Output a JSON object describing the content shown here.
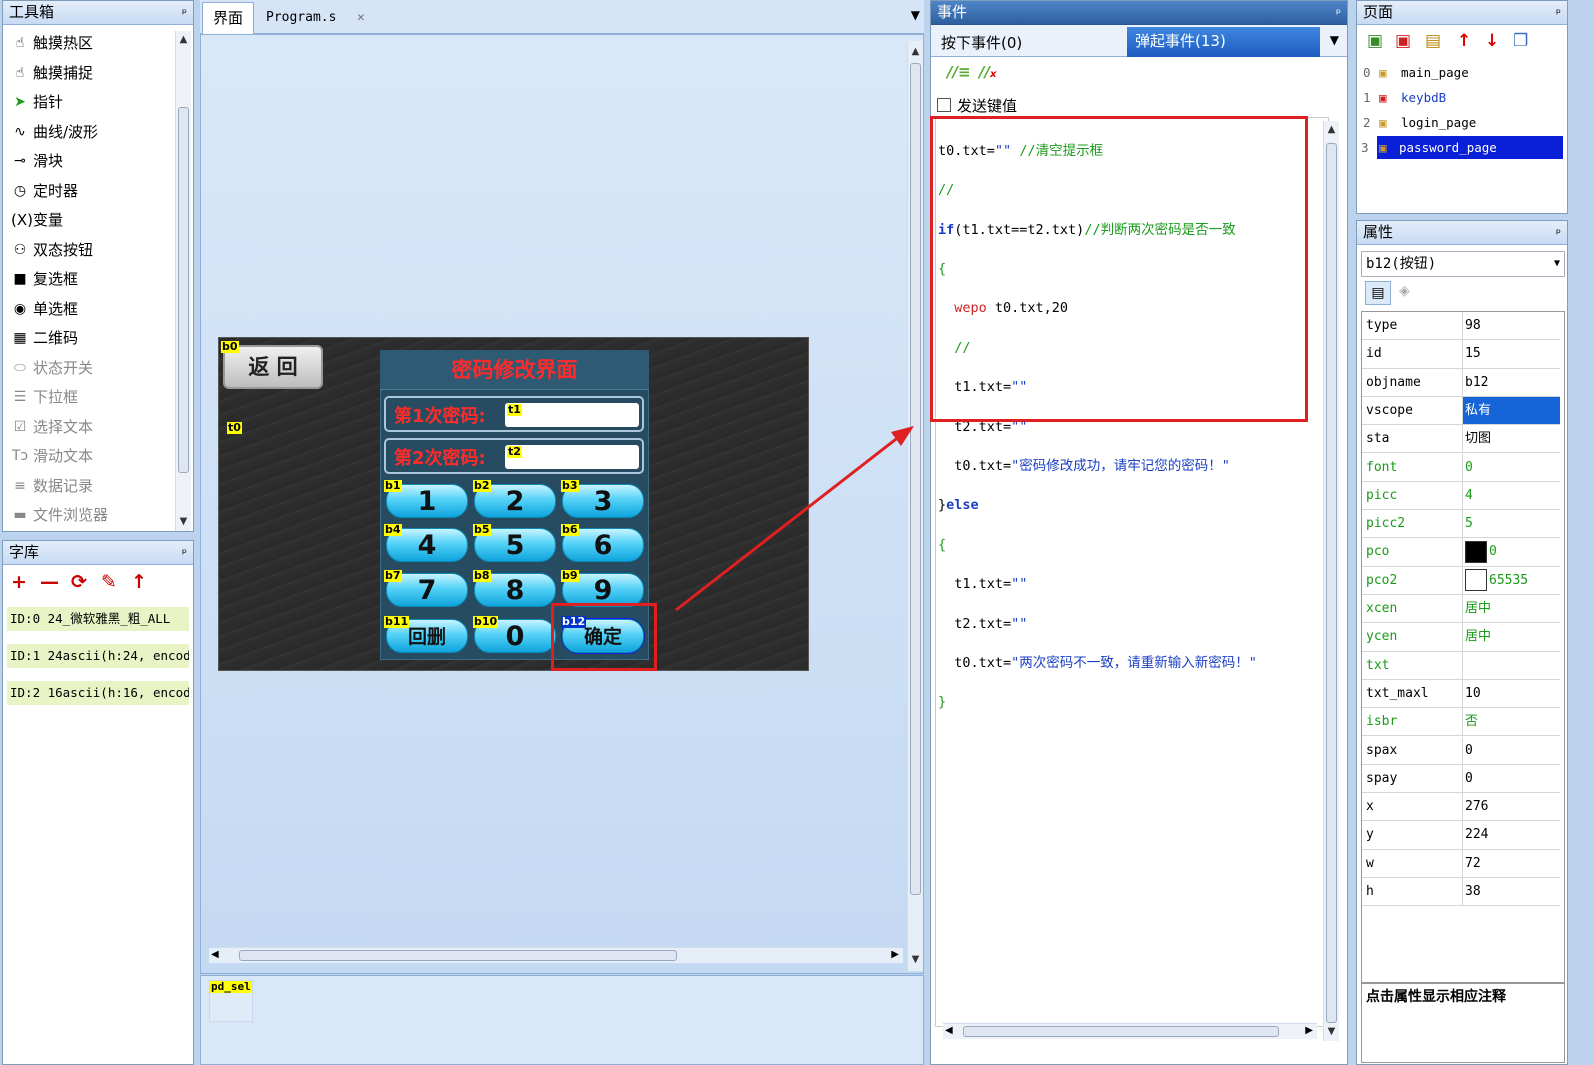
{
  "toolbox": {
    "title": "工具箱",
    "pin": "ᵖ",
    "items": [
      {
        "label": "触摸热区",
        "icon": "☝",
        "disabled": false
      },
      {
        "label": "触摸捕捉",
        "icon": "☝",
        "disabled": false
      },
      {
        "label": "指针",
        "icon": "➤",
        "disabled": false
      },
      {
        "label": "曲线/波形",
        "icon": "∿",
        "disabled": false
      },
      {
        "label": "滑块",
        "icon": "⊸",
        "disabled": false
      },
      {
        "label": "定时器",
        "icon": "◷",
        "disabled": false
      },
      {
        "label": "(X)变量",
        "icon": "",
        "disabled": false
      },
      {
        "label": "双态按钮",
        "icon": "⚇",
        "disabled": false
      },
      {
        "label": "复选框",
        "icon": "■",
        "disabled": false
      },
      {
        "label": "单选框",
        "icon": "◉",
        "disabled": false
      },
      {
        "label": "二维码",
        "icon": "▦",
        "disabled": false
      },
      {
        "label": "状态开关",
        "icon": "⬭",
        "disabled": true
      },
      {
        "label": "下拉框",
        "icon": "☰",
        "disabled": true
      },
      {
        "label": "选择文本",
        "icon": "☑",
        "disabled": true
      },
      {
        "label": "滑动文本",
        "icon": "Tↄ",
        "disabled": true
      },
      {
        "label": "数据记录",
        "icon": "≡",
        "disabled": true
      },
      {
        "label": "文件浏览器",
        "icon": "▬",
        "disabled": true
      }
    ]
  },
  "fonts": {
    "title": "字库",
    "toolbar": [
      "+",
      "—",
      "⟳",
      "✎",
      "↑"
    ],
    "items": [
      "ID:0   24_微软雅黑_粗_ALL",
      "ID:1   24ascii(h:24, encode",
      "ID:2   16ascii(h:16, encode"
    ]
  },
  "editor": {
    "tabs": [
      {
        "label": "界面"
      },
      {
        "label": "Program.s"
      }
    ],
    "close_tab": "✕",
    "dropdown": "▼",
    "bottom_label": "pd_sel"
  },
  "hmi": {
    "back_label": "返 回",
    "title": "密码修改界面",
    "pwd1_label": "第1次密码:",
    "pwd2_label": "第2次密码:",
    "tags": {
      "b0": "b0",
      "t0": "t0",
      "t1": "t1",
      "t2": "t2",
      "b1": "b1",
      "b2": "b2",
      "b3": "b3",
      "b4": "b4",
      "b5": "b5",
      "b6": "b6",
      "b7": "b7",
      "b8": "b8",
      "b9": "b9",
      "b10": "b10",
      "b11": "b11",
      "b12": "b12"
    },
    "keys": {
      "k1": "1",
      "k2": "2",
      "k3": "3",
      "k4": "4",
      "k5": "5",
      "k6": "6",
      "k7": "7",
      "k8": "8",
      "k9": "9",
      "k0": "0",
      "del": "回删",
      "ok": "确定"
    }
  },
  "events": {
    "title": "事件",
    "tab_press": "按下事件(0)",
    "tab_release": "弹起事件(13)",
    "send_key_label": "发送键值",
    "code_lines": [
      "t0.txt=\"\" //清空提示框",
      "//",
      "if(t1.txt==t2.txt)//判断两次密码是否一致",
      "{",
      "  wepo t0.txt,20",
      "  //",
      "  t1.txt=\"\"",
      "  t2.txt=\"\"",
      "  t0.txt=\"密码修改成功，请牢记您的密码！\"",
      "}else",
      "{",
      "  t1.txt=\"\"",
      "  t2.txt=\"\"",
      "  t0.txt=\"两次密码不一致，请重新输入新密码！\"",
      "}"
    ]
  },
  "pages": {
    "title": "页面",
    "items": [
      {
        "index": "0",
        "name": "main_page"
      },
      {
        "index": "1",
        "name": "keybdB"
      },
      {
        "index": "2",
        "name": "login_page"
      },
      {
        "index": "3",
        "name": "password_page"
      }
    ]
  },
  "props": {
    "title": "属性",
    "selected": "b12(按钮)",
    "rows": [
      {
        "k": "type",
        "v": "98",
        "green": false
      },
      {
        "k": "id",
        "v": "15",
        "green": false
      },
      {
        "k": "objname",
        "v": "b12",
        "green": false
      },
      {
        "k": "vscope",
        "v": "私有",
        "green": false
      },
      {
        "k": "sta",
        "v": "切图",
        "green": false
      },
      {
        "k": "font",
        "v": "0",
        "green": true
      },
      {
        "k": "picc",
        "v": "4",
        "green": true
      },
      {
        "k": "picc2",
        "v": "5",
        "green": true
      },
      {
        "k": "pco",
        "v": "0",
        "green": true
      },
      {
        "k": "pco2",
        "v": "65535",
        "green": true
      },
      {
        "k": "xcen",
        "v": "居中",
        "green": true
      },
      {
        "k": "ycen",
        "v": "居中",
        "green": true
      },
      {
        "k": "txt",
        "v": "",
        "green": true
      },
      {
        "k": "txt_maxl",
        "v": "10",
        "green": false
      },
      {
        "k": "isbr",
        "v": "否",
        "green": true
      },
      {
        "k": "spax",
        "v": "0",
        "green": false
      },
      {
        "k": "spay",
        "v": "0",
        "green": false
      },
      {
        "k": "x",
        "v": "276",
        "green": false
      },
      {
        "k": "y",
        "v": "224",
        "green": false
      },
      {
        "k": "w",
        "v": "72",
        "green": false
      },
      {
        "k": "h",
        "v": "38",
        "green": false
      }
    ],
    "hint": "点击属性显示相应注释"
  },
  "colors": {
    "highlight_red": "#e02020",
    "selection_blue": "#0033cc",
    "tag_yellow": "#ffff00"
  }
}
